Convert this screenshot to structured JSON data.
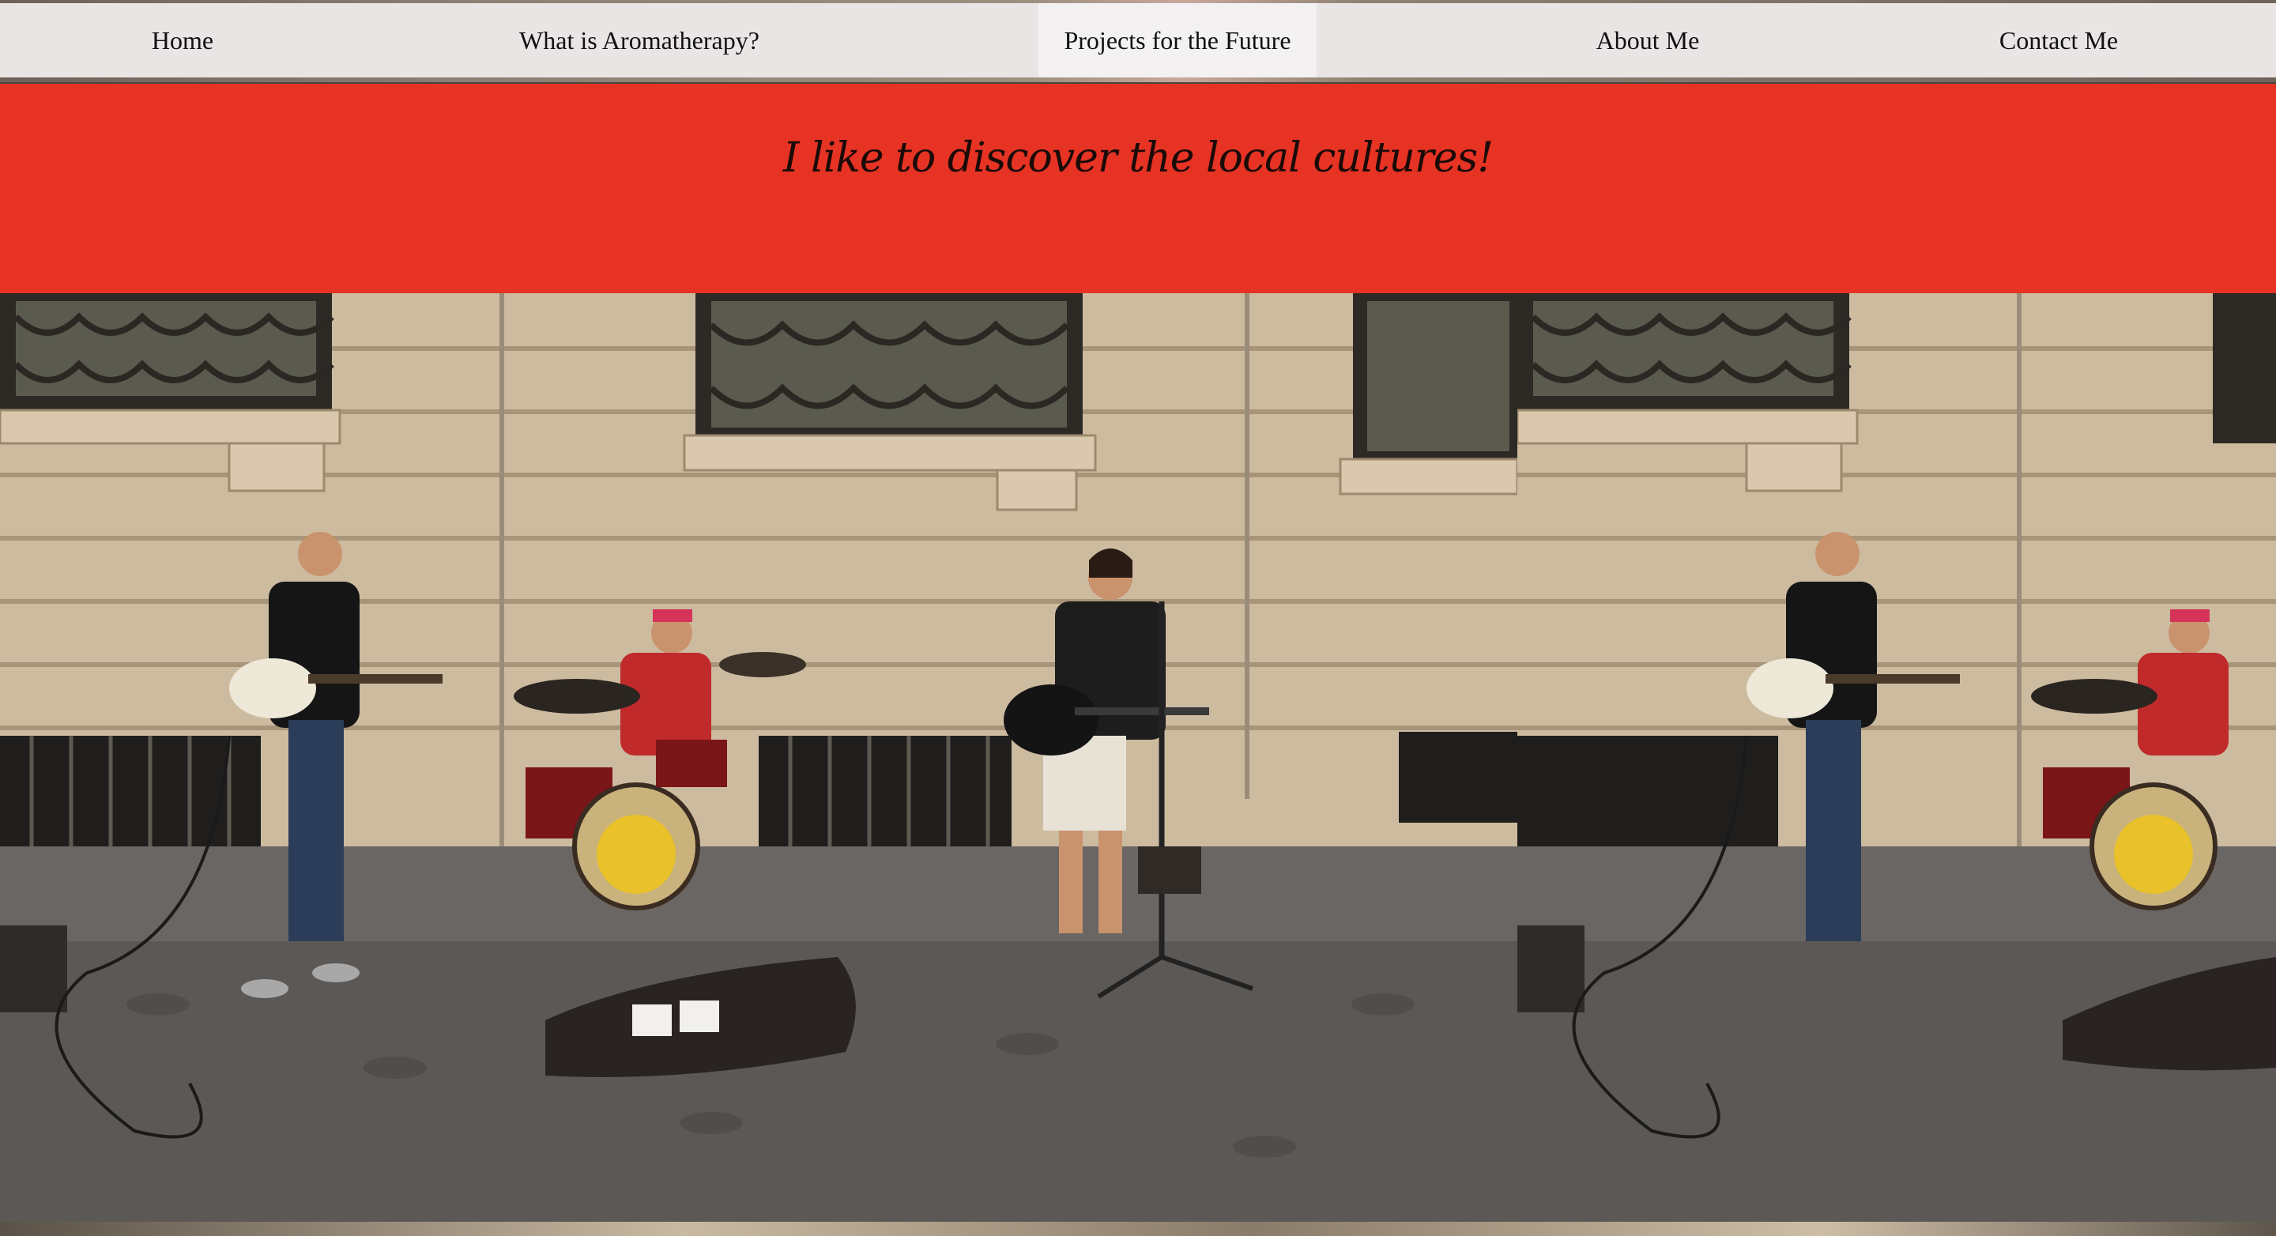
{
  "nav": {
    "items": [
      {
        "label": "Home"
      },
      {
        "label": "What is Aromatherapy?"
      },
      {
        "label": "Projects for the Future",
        "active": true
      },
      {
        "label": "About Me"
      },
      {
        "label": "Contact Me"
      }
    ]
  },
  "banner": {
    "text": "I like to discover the local cultures!",
    "background": "#e63323"
  },
  "photo": {
    "subject": "street-musicians-photo"
  }
}
